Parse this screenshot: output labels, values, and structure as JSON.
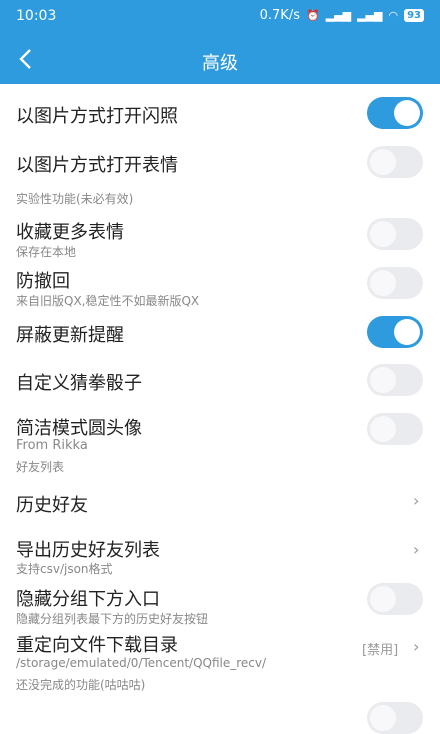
{
  "status": {
    "time": "10:03",
    "speed": "0.7K/s",
    "battery": "93"
  },
  "header": {
    "title": "高级"
  },
  "items": {
    "flash_as_image": {
      "label": "以图片方式打开闪照",
      "on": true
    },
    "emoji_as_image": {
      "label": "以图片方式打开表情",
      "on": false
    },
    "experimental_hint": "实验性功能(未必有效)",
    "collect_more": {
      "label": "收藏更多表情",
      "sub": "保存在本地",
      "on": false
    },
    "anti_recall": {
      "label": "防撤回",
      "sub": "来自旧版QX,稳定性不如最新版QX",
      "on": false
    },
    "block_update": {
      "label": "屏蔽更新提醒",
      "on": true
    },
    "custom_dice": {
      "label": "自定义猜拳骰子",
      "on": false
    },
    "round_avatar": {
      "label": "简洁模式圆头像",
      "sub1": "From Rikka",
      "sub2": "好友列表",
      "on": false
    },
    "history_friends": {
      "label": "历史好友"
    },
    "export_history": {
      "label": "导出历史好友列表",
      "sub": "支持csv/json格式"
    },
    "hide_group_entry": {
      "label": "隐藏分组下方入口",
      "sub": "隐藏分组列表最下方的历史好友按钮",
      "on": false
    },
    "redirect_download": {
      "label": "重定向文件下载目录",
      "sub1": "/storage/emulated/0/Tencent/QQfile_recv/",
      "sub2": "还没完成的功能(咕咕咕)",
      "tag": "[禁用]"
    }
  },
  "icons": {
    "back": "back-arrow-icon",
    "chevron": "chevron-right-icon"
  },
  "colors": {
    "accent": "#2e9bde",
    "toggle_off": "#eaebef"
  }
}
